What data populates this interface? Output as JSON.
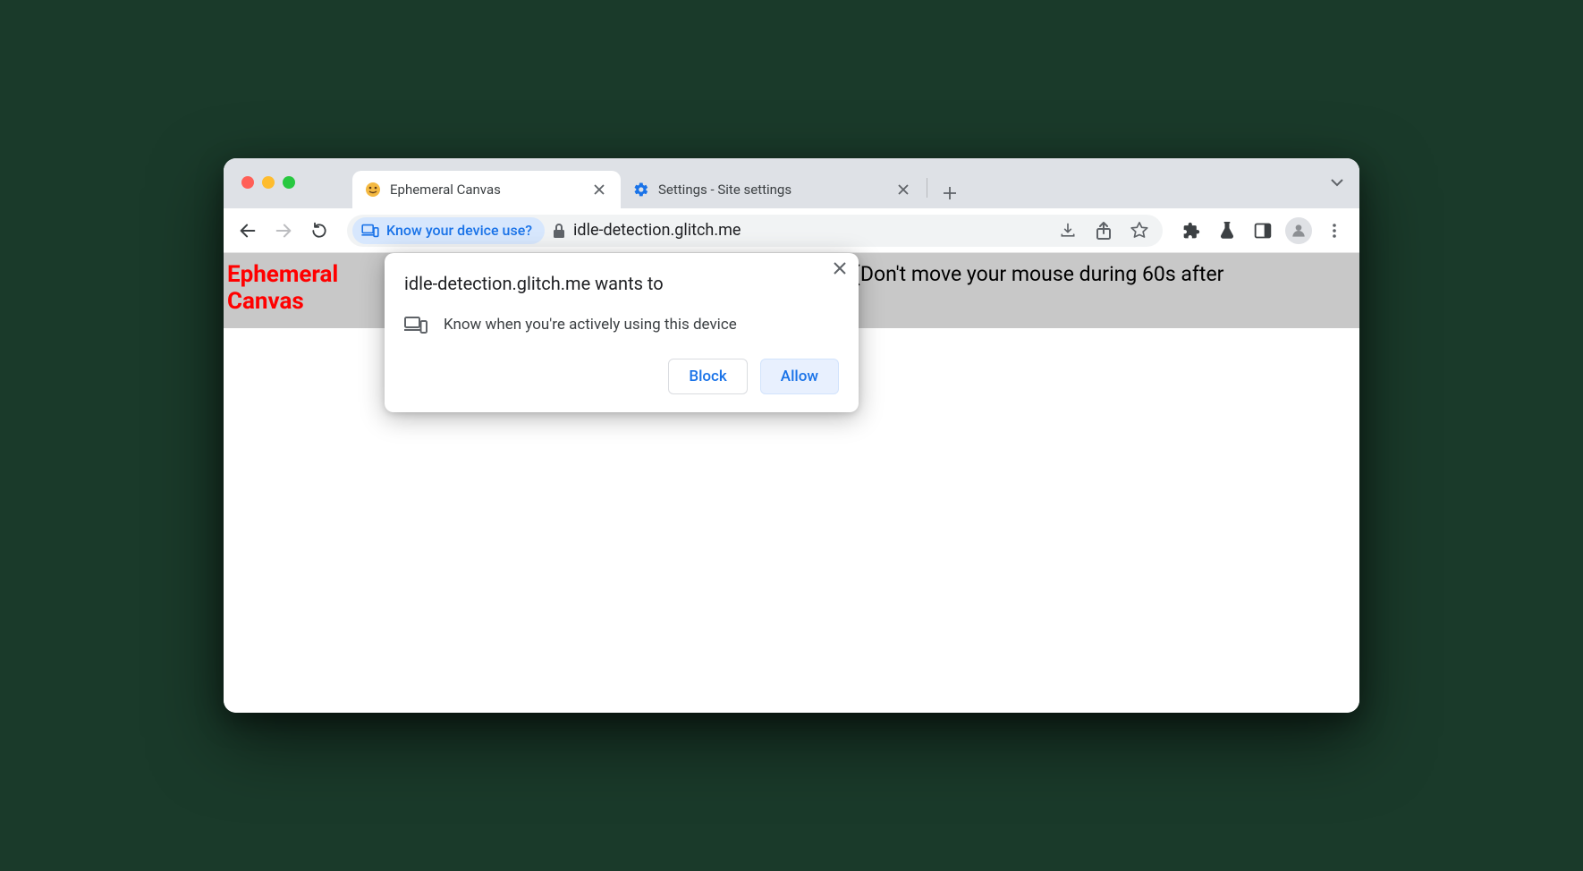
{
  "tabs": [
    {
      "title": "Ephemeral Canvas",
      "active": true
    },
    {
      "title": "Settings - Site settings",
      "active": false
    }
  ],
  "omnibox": {
    "chip_label": "Know your device use?",
    "url": "idle-detection.glitch.me"
  },
  "page": {
    "title_line1": "Ephemeral",
    "title_line2": "Canvas",
    "instruction": "(Don't move your mouse during 60s after"
  },
  "popup": {
    "title": "idle-detection.glitch.me wants to",
    "permission_text": "Know when you're actively using this device",
    "block_label": "Block",
    "allow_label": "Allow"
  }
}
